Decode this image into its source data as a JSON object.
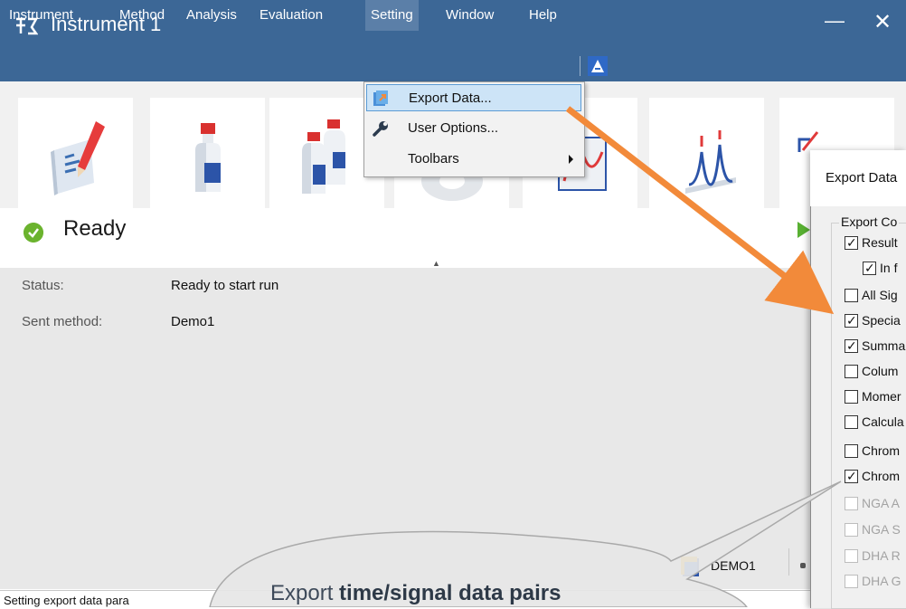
{
  "window": {
    "title": "Instrument 1",
    "minimize": "—",
    "close": "✕"
  },
  "menu": {
    "items": [
      "Instrument",
      "Method",
      "Analysis",
      "Evaluation",
      "Setting",
      "Window",
      "Help"
    ],
    "active": "Setting"
  },
  "dropdown": {
    "items": [
      {
        "label": "Export Data...",
        "icon": "export-data-icon"
      },
      {
        "label": "User Options...",
        "icon": "wrench-icon"
      },
      {
        "label": "Toolbars",
        "icon": "submenu-arrow-icon"
      }
    ]
  },
  "toolbar": {
    "tiles": [
      "notepad-pencil-icon",
      "bottle-icon",
      "bottles-icon",
      "disc-icon",
      "chart-icon",
      "peaks-icon",
      "calibration-icon"
    ]
  },
  "status": {
    "state": "Ready",
    "rows": [
      {
        "label": "Status:",
        "value": "Ready to start run"
      },
      {
        "label": "Sent method:",
        "value": "Demo1"
      }
    ],
    "bottom_text": "Setting export data para",
    "method_badge": "DEMO1"
  },
  "dialog": {
    "title": "Export Data",
    "group_label": "Export Co",
    "checkboxes": [
      {
        "label": "Result",
        "checked": true,
        "enabled": true,
        "indent": 0
      },
      {
        "label": "In f",
        "checked": true,
        "enabled": true,
        "indent": 1
      },
      {
        "label": "All Sig",
        "checked": false,
        "enabled": true,
        "indent": 0
      },
      {
        "label": "Specia",
        "checked": true,
        "enabled": true,
        "indent": 0
      },
      {
        "label": "Summa",
        "checked": true,
        "enabled": true,
        "indent": 0
      },
      {
        "label": "Colum",
        "checked": false,
        "enabled": true,
        "indent": 0
      },
      {
        "label": "Momer",
        "checked": false,
        "enabled": true,
        "indent": 0
      },
      {
        "label": "Calcula",
        "checked": false,
        "enabled": true,
        "indent": 0
      },
      {
        "label": "Chrom",
        "checked": false,
        "enabled": true,
        "indent": 0
      },
      {
        "label": "Chrom",
        "checked": true,
        "enabled": true,
        "indent": 0
      },
      {
        "label": "NGA A",
        "checked": false,
        "enabled": false,
        "indent": 0
      },
      {
        "label": "NGA S",
        "checked": false,
        "enabled": false,
        "indent": 0
      },
      {
        "label": "DHA R",
        "checked": false,
        "enabled": false,
        "indent": 0
      },
      {
        "label": "DHA G",
        "checked": false,
        "enabled": false,
        "indent": 0
      }
    ]
  },
  "callout": {
    "prefix": "Export ",
    "bold": "time/signal data pairs"
  },
  "colors": {
    "titlebar": "#3c6796",
    "accent_arrow": "#f28a3a",
    "ready_green": "#6bb32e"
  }
}
